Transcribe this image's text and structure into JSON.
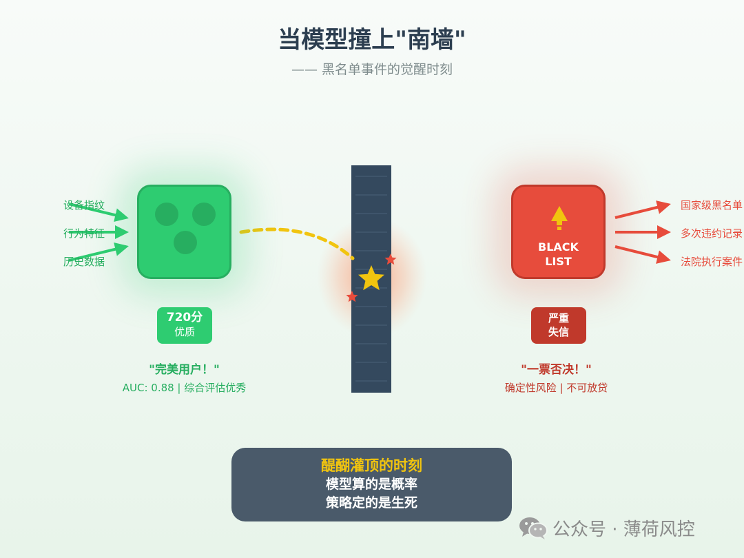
{
  "header": {
    "title": "当模型撞上\"南墙\"",
    "subtitle": "—— 黑名单事件的觉醒时刻"
  },
  "left": {
    "inputs": [
      "设备指纹",
      "行为特征",
      "历史数据"
    ],
    "score_badge": {
      "score": "720分",
      "grade": "优质"
    },
    "quote": "\"完美用户！\"",
    "note": "AUC: 0.88 | 综合评估优秀"
  },
  "right": {
    "box_text": [
      "BLACK",
      "LIST"
    ],
    "badge": {
      "line1": "严重",
      "line2": "失信"
    },
    "outputs": [
      "国家级黑名单",
      "多次违约记录",
      "法院执行案件"
    ],
    "quote": "\"一票否决！\"",
    "note": "确定性风险 | 不可放贷"
  },
  "insight": {
    "title": "醍醐灌顶的时刻",
    "lines": [
      "模型算的是概率",
      "策略定的是生死"
    ]
  },
  "footer": {
    "text": "公众号 · 薄荷风控",
    "icon": "wechat-icon"
  },
  "colors": {
    "green": "#2ecc71",
    "green_dark": "#27ae60",
    "red": "#e74c3c",
    "red_dark": "#c0392b",
    "wall": "#34495e",
    "gold": "#f1c40f",
    "insight_bg": "#4a5a6a"
  }
}
